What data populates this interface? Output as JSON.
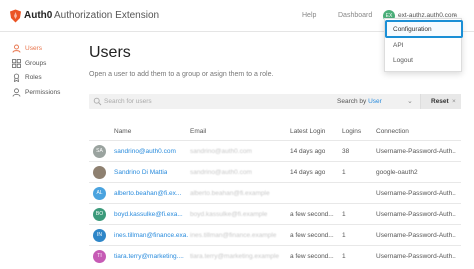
{
  "header": {
    "brand": "Auth0",
    "app_title": "Authorization Extension",
    "help_label": "Help",
    "dashboard_label": "Dashboard",
    "avatar_initials": "EX",
    "account_name": "ext-authz.auth0.com",
    "avatar_color": "#4caf7a"
  },
  "account_menu": {
    "items": [
      {
        "label": "Configuration",
        "highlighted": true
      },
      {
        "label": "API"
      },
      {
        "label": "Logout"
      }
    ],
    "highlight_color": "#1a8fd6"
  },
  "sidebar": {
    "items": [
      {
        "label": "Users",
        "icon": "user-icon",
        "active": true
      },
      {
        "label": "Groups",
        "icon": "groups-icon"
      },
      {
        "label": "Roles",
        "icon": "roles-icon"
      },
      {
        "label": "Permissions",
        "icon": "permissions-icon"
      }
    ],
    "active_color": "#e8734a"
  },
  "main": {
    "title": "Users",
    "subtitle": "Open a user to add them to a group or asign them to a role.",
    "search": {
      "placeholder": "Search for users",
      "search_by_prefix": "Search by",
      "search_by_value": "User",
      "reset_label": "Reset",
      "reset_x": "×"
    },
    "table": {
      "columns": [
        "Name",
        "Email",
        "Latest Login",
        "Logins",
        "Connection"
      ],
      "rows": [
        {
          "initials": "SA",
          "color": "#9aa39f",
          "name": "sandrino@auth0.com",
          "email": "sandrino@auth0.com",
          "latest_login": "14 days ago",
          "logins": "38",
          "connection": "Username-Password-Auth..."
        },
        {
          "initials": "",
          "color": "#8e8070",
          "name": "Sandrino Di Mattia",
          "email": "sandrino@auth0.com",
          "latest_login": "14 days ago",
          "logins": "1",
          "connection": "google-oauth2"
        },
        {
          "initials": "AL",
          "color": "#4aa3df",
          "name": "alberto.beahan@fi.ex...",
          "email": "alberto.beahan@fi.example",
          "latest_login": "",
          "logins": "",
          "connection": "Username-Password-Auth..."
        },
        {
          "initials": "BO",
          "color": "#3b9a7a",
          "name": "boyd.kassulke@fi.exa...",
          "email": "boyd.kassulke@fi.example",
          "latest_login": "a few second...",
          "logins": "1",
          "connection": "Username-Password-Auth..."
        },
        {
          "initials": "IN",
          "color": "#2e86c8",
          "name": "ines.tillman@finance.exa...",
          "email": "ines.tillman@finance.example",
          "latest_login": "a few second...",
          "logins": "1",
          "connection": "Username-Password-Auth..."
        },
        {
          "initials": "TI",
          "color": "#c65bb5",
          "name": "tiara.terry@marketing....",
          "email": "tiara.terry@marketing.example",
          "latest_login": "a few second...",
          "logins": "1",
          "connection": "Username-Password-Auth..."
        }
      ]
    }
  }
}
